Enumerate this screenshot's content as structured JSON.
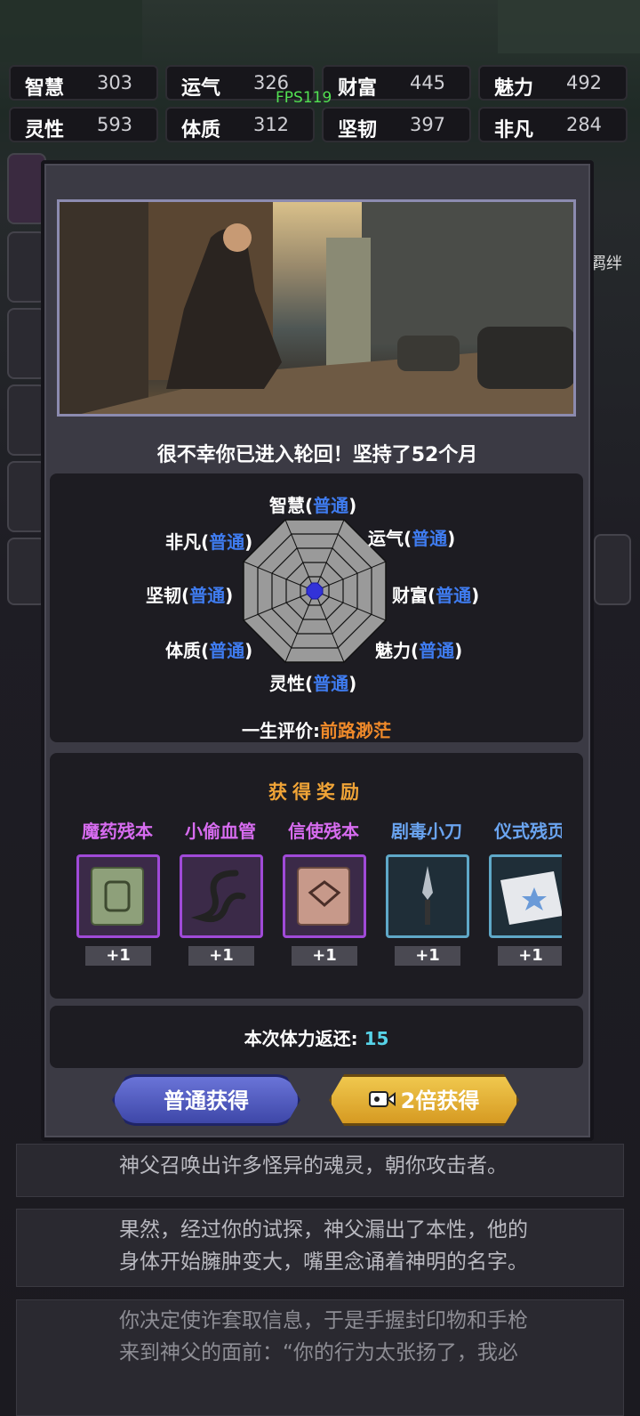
{
  "hud": {
    "fps": "FPS119",
    "stats": [
      {
        "label": "智慧",
        "value": "303"
      },
      {
        "label": "运气",
        "value": "326"
      },
      {
        "label": "财富",
        "value": "445"
      },
      {
        "label": "魅力",
        "value": "492"
      },
      {
        "label": "灵性",
        "value": "593"
      },
      {
        "label": "体质",
        "value": "312"
      },
      {
        "label": "坚韧",
        "value": "397"
      },
      {
        "label": "非凡",
        "value": "284"
      }
    ],
    "side_label": "羁绊"
  },
  "result": {
    "headline": "很不幸你已进入轮回！坚持了52个月",
    "radar": [
      {
        "attr": "智慧",
        "grade": "普通"
      },
      {
        "attr": "运气",
        "grade": "普通"
      },
      {
        "attr": "财富",
        "grade": "普通"
      },
      {
        "attr": "魅力",
        "grade": "普通"
      },
      {
        "attr": "灵性",
        "grade": "普通"
      },
      {
        "attr": "体质",
        "grade": "普通"
      },
      {
        "attr": "坚韧",
        "grade": "普通"
      },
      {
        "attr": "非凡",
        "grade": "普通"
      }
    ],
    "evaluation_label": "一生评价:",
    "evaluation_value": "前路渺茫"
  },
  "rewards": {
    "title": "获得奖励",
    "items": [
      {
        "name": "魔药残本",
        "count": "+1",
        "name_color": "#d76cf0",
        "rarity": "purple"
      },
      {
        "name": "小偷血管",
        "count": "+1",
        "name_color": "#d76cf0",
        "rarity": "purple"
      },
      {
        "name": "信使残本",
        "count": "+1",
        "name_color": "#d76cf0",
        "rarity": "purple"
      },
      {
        "name": "剧毒小刀",
        "count": "+1",
        "name_color": "#6aa4f0",
        "rarity": "blue"
      },
      {
        "name": "仪式残页",
        "count": "+1",
        "name_color": "#6aa4f0",
        "rarity": "blue"
      }
    ]
  },
  "stamina": {
    "label": "本次体力返还:",
    "value": "15"
  },
  "buttons": {
    "normal": "普通获得",
    "double": "2倍获得"
  },
  "story": [
    "神父召唤出许多怪异的魂灵，朝你攻击者。",
    "果然，经过你的试探，神父漏出了本性，他的",
    "身体开始臃肿变大，嘴里念诵着神明的名字。",
    "你决定使诈套取信息，于是手握封印物和手枪",
    "来到神父的面前：“你的行为太张扬了，我必"
  ]
}
